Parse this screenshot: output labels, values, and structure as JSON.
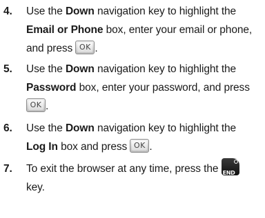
{
  "steps": [
    {
      "number": "4.",
      "parts": {
        "a1": "Use the ",
        "b1": "Down",
        "a2": " navigation key to highlight the",
        "b2": "Email or Phone",
        "a3": " box, enter your email or phone,",
        "a4": "and press ",
        "a5": "."
      }
    },
    {
      "number": "5.",
      "parts": {
        "a1": "Use the ",
        "b1": "Down",
        "a2": " navigation key to highlight the",
        "b2": "Password",
        "a3": " box, enter your password, and press",
        "a5": "."
      }
    },
    {
      "number": "6.",
      "parts": {
        "a1": "Use the ",
        "b1": "Down",
        "a2": " navigation key to highlight the",
        "b2": "Log In",
        "a3": " box and press ",
        "a5": "."
      }
    },
    {
      "number": "7.",
      "parts": {
        "a1": "To exit the browser at any time, press the ",
        "a2": "key."
      }
    }
  ],
  "keys": {
    "ok_label": "OK",
    "end_label": "END",
    "end_icon": "power-icon"
  }
}
